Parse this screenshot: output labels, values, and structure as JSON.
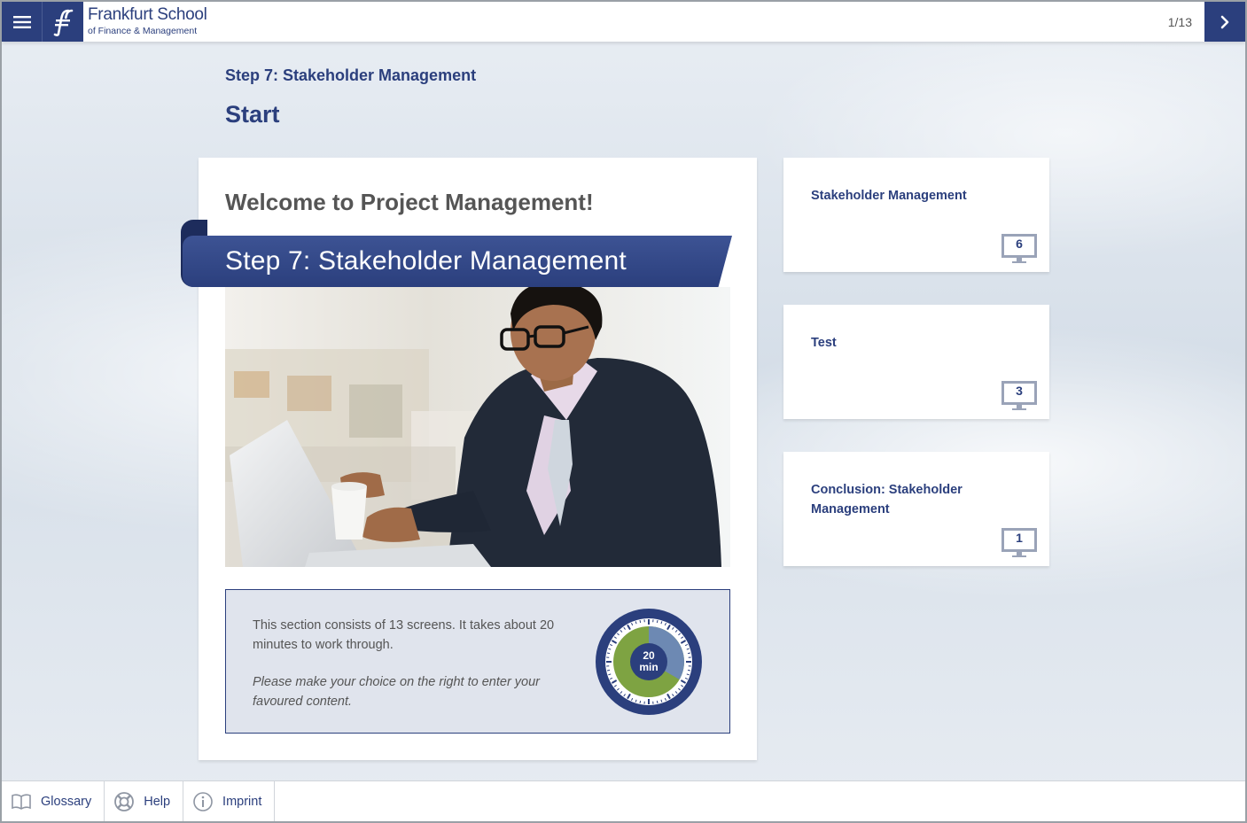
{
  "header": {
    "brand_name": "Frankfurt School",
    "brand_sub": "of Finance & Management",
    "page_counter": "1/13",
    "menu_icon": "hamburger-icon",
    "next_icon": "chevron-right-icon"
  },
  "main": {
    "step_heading": "Step 7: Stakeholder Management",
    "section_title": "Start",
    "welcome_title": "Welcome to Project Management!",
    "ribbon_text": "Step 7: Stakeholder Management",
    "info_text": "This section consists of 13 screens. It takes about 20 minutes to work through.",
    "info_hint": "Please make your choice on the right to enter your favoured content.",
    "timer": {
      "value": "20",
      "unit": "min"
    }
  },
  "side_cards": [
    {
      "title": "Stakeholder Management",
      "count": "6"
    },
    {
      "title": "Test",
      "count": "3"
    },
    {
      "title": "Conclusion: Stakeholder Management",
      "count": "1"
    }
  ],
  "footer": {
    "items": [
      {
        "label": "Glossary",
        "icon": "book-icon"
      },
      {
        "label": "Help",
        "icon": "lifebuoy-icon"
      },
      {
        "label": "Imprint",
        "icon": "info-icon"
      }
    ]
  },
  "colors": {
    "brand": "#2b3f7d",
    "timer_green": "#7ea342",
    "timer_blue_light": "#6d89b3"
  }
}
